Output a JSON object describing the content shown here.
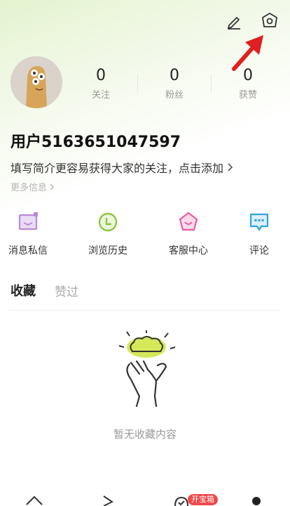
{
  "header": {
    "edit_icon": "pencil-icon",
    "settings_icon": "hexagon-settings-icon"
  },
  "profile": {
    "avatar": "avatar",
    "username": "用户5163651047597",
    "bio_prompt": "填写简介更容易获得大家的关注，点击添加",
    "more_info": "更多信息"
  },
  "stats": [
    {
      "value": "0",
      "label": "关注"
    },
    {
      "value": "0",
      "label": "粉丝"
    },
    {
      "value": "0",
      "label": "获赞"
    }
  ],
  "quick_actions": [
    {
      "label": "消息私信",
      "icon": "message-icon",
      "color": "#b98ad8"
    },
    {
      "label": "浏览历史",
      "icon": "history-clock-icon",
      "color": "#8cc63f"
    },
    {
      "label": "客服中心",
      "icon": "customer-service-icon",
      "color": "#e85aa0"
    },
    {
      "label": "评论",
      "icon": "comment-icon",
      "color": "#2ea4dc"
    }
  ],
  "tabs": {
    "active": "收藏",
    "inactive": "赞过"
  },
  "empty_state": {
    "text": "暂无收藏内容"
  },
  "bottom_nav": {
    "badge": "开宝箱"
  },
  "colors": {
    "accent_green": "#8cc63f",
    "badge_red": "#f04848",
    "arrow_red": "#e02020"
  }
}
